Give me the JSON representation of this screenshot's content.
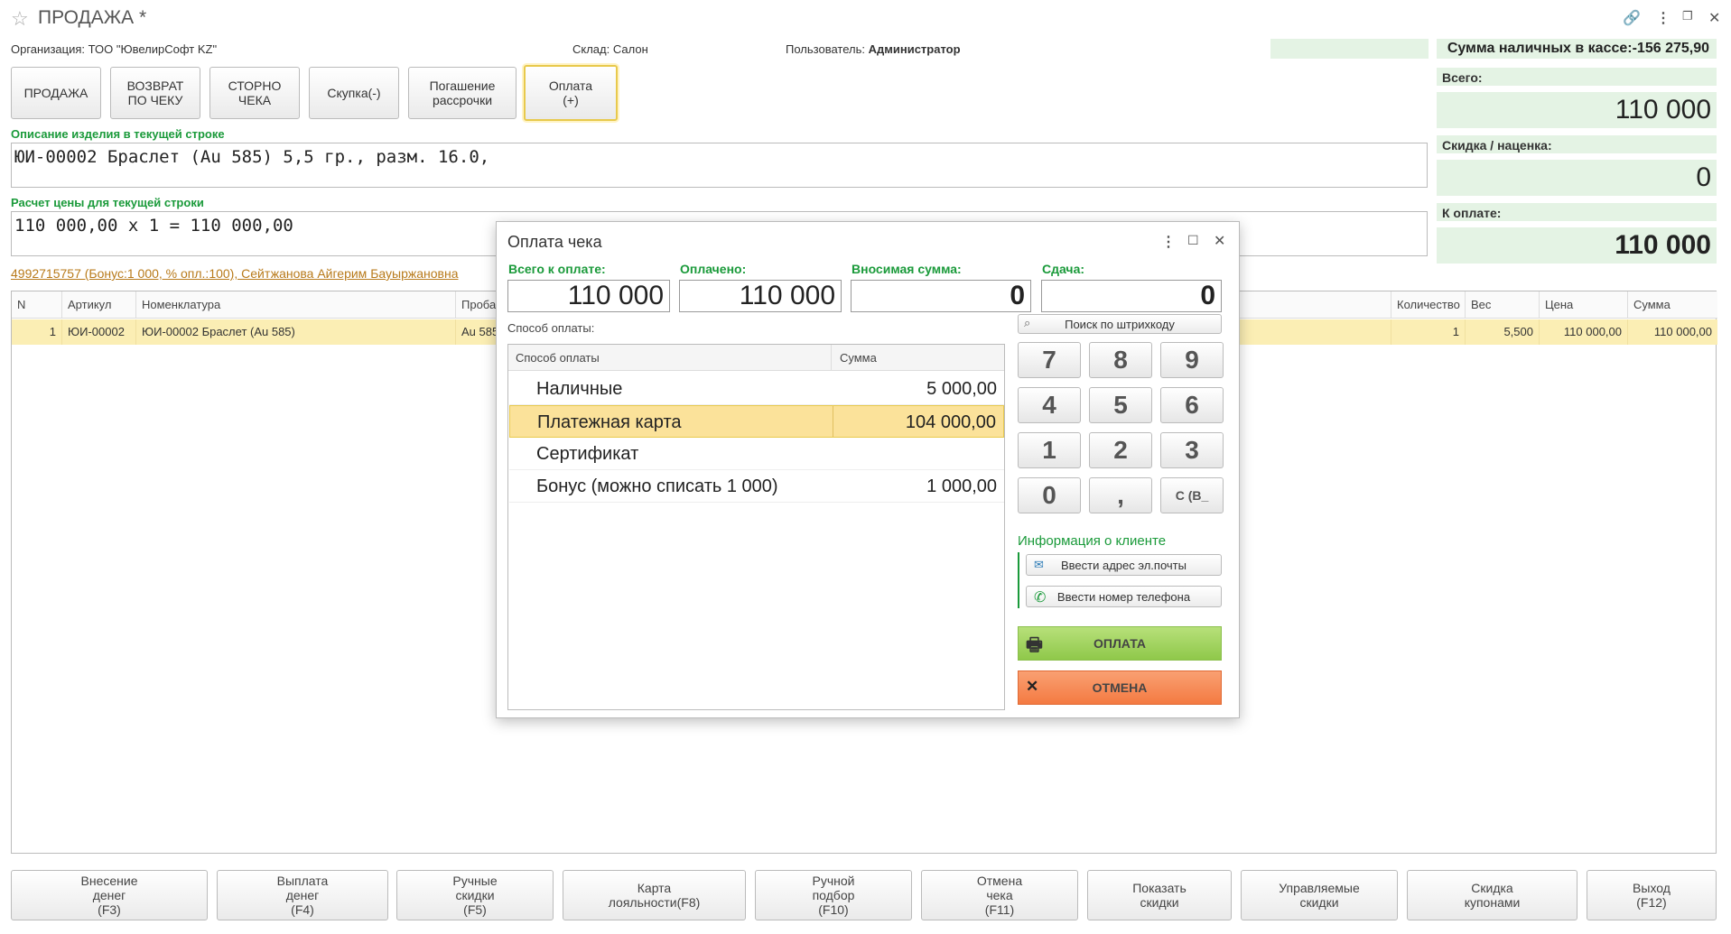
{
  "window": {
    "title": "ПРОДАЖА *"
  },
  "info": {
    "org_label": "Организация:",
    "org_value": "ТОО \"ЮвелирСофт KZ\"",
    "warehouse_label": "Склад:",
    "warehouse_value": "Салон",
    "user_label": "Пользователь:",
    "user_value": "Администратор"
  },
  "top_buttons": [
    {
      "label": "ПРОДАЖА"
    },
    {
      "label": "ВОЗВРАТ\nПО ЧЕКУ"
    },
    {
      "label": "СТОРНО\nЧЕКА"
    },
    {
      "label": "Скупка(-)"
    },
    {
      "label": "Погашение\nрассрочки"
    },
    {
      "label": "Оплата\n(+)"
    }
  ],
  "description": {
    "label": "Описание изделия в текущей строке",
    "value": "ЮИ-00002 Браслет (Au 585) 5,5 гр., разм. 16.0,"
  },
  "price_calc": {
    "label": "Расчет цены для текущей строки",
    "value": "110 000,00 х 1 = 110 000,00"
  },
  "client_link": "4992715757 (Бонус:1 000, % опл.:100), Сейтжанова Айгерим Бауыржановна",
  "right_panel": {
    "cash_label": "Сумма наличных в кассе:-156 275,90",
    "total_label": "Всего:",
    "total_value": "110 000",
    "discount_label": "Скидка / наценка:",
    "discount_value": "0",
    "topay_label": "К оплате:",
    "topay_value": "110 000"
  },
  "table": {
    "headers": [
      "N",
      "Артикул",
      "Номенклатура",
      "Проба",
      "Количество",
      "Вес",
      "Цена",
      "Сумма"
    ],
    "rows": [
      [
        "1",
        "ЮИ-00002",
        "ЮИ-00002 Браслет (Au 585)",
        "Au 585",
        "1",
        "5,500",
        "110 000,00",
        "110 000,00"
      ]
    ]
  },
  "bottom_buttons": [
    {
      "label": "Внесение\nденег\n(F3)"
    },
    {
      "label": "Выплата\nденег\n(F4)"
    },
    {
      "label": "Ручные\nскидки\n(F5)"
    },
    {
      "label": "Карта\nлояльности(F8)"
    },
    {
      "label": "Ручной\nподбор\n(F10)"
    },
    {
      "label": "Отмена\nчека\n(F11)"
    },
    {
      "label": "Показать\nскидки"
    },
    {
      "label": "Управляемые\nскидки"
    },
    {
      "label": "Скидка\nкупонами"
    },
    {
      "label": "Выход\n(F12)"
    }
  ],
  "dialog": {
    "title": "Оплата чека",
    "total_label": "Всего к оплате:",
    "total_value": "110 000",
    "paid_label": "Оплачено:",
    "paid_value": "110 000",
    "input_label": "Вносимая сумма:",
    "input_value": "0",
    "change_label": "Сдача:",
    "change_value": "0",
    "method_label": "Способ оплаты:",
    "col_method": "Способ оплаты",
    "col_sum": "Сумма",
    "payments": [
      {
        "name": "Наличные",
        "sum": "5 000,00"
      },
      {
        "name": "Платежная карта",
        "sum": "104 000,00"
      },
      {
        "name": "Сертификат",
        "sum": ""
      },
      {
        "name": "Бонус (можно списать 1 000)",
        "sum": "1 000,00"
      }
    ],
    "barcode_label": "Поиск по штрихкоду",
    "keys": [
      "7",
      "8",
      "9",
      "4",
      "5",
      "6",
      "1",
      "2",
      "3",
      "0",
      ",",
      "C (B_"
    ],
    "client_info_label": "Информация о клиенте",
    "email_label": "Ввести адрес эл.почты",
    "phone_label": "Ввести номер телефона",
    "pay_label": "ОПЛАТА",
    "cancel_label": "ОТМЕНА"
  },
  "colors": {
    "accent_green": "#1a9a3a",
    "highlight": "#fbeeb4",
    "panel_green": "#e4f3e4",
    "pay_green": "#9ed25a",
    "cancel_orange": "#f5874f"
  }
}
